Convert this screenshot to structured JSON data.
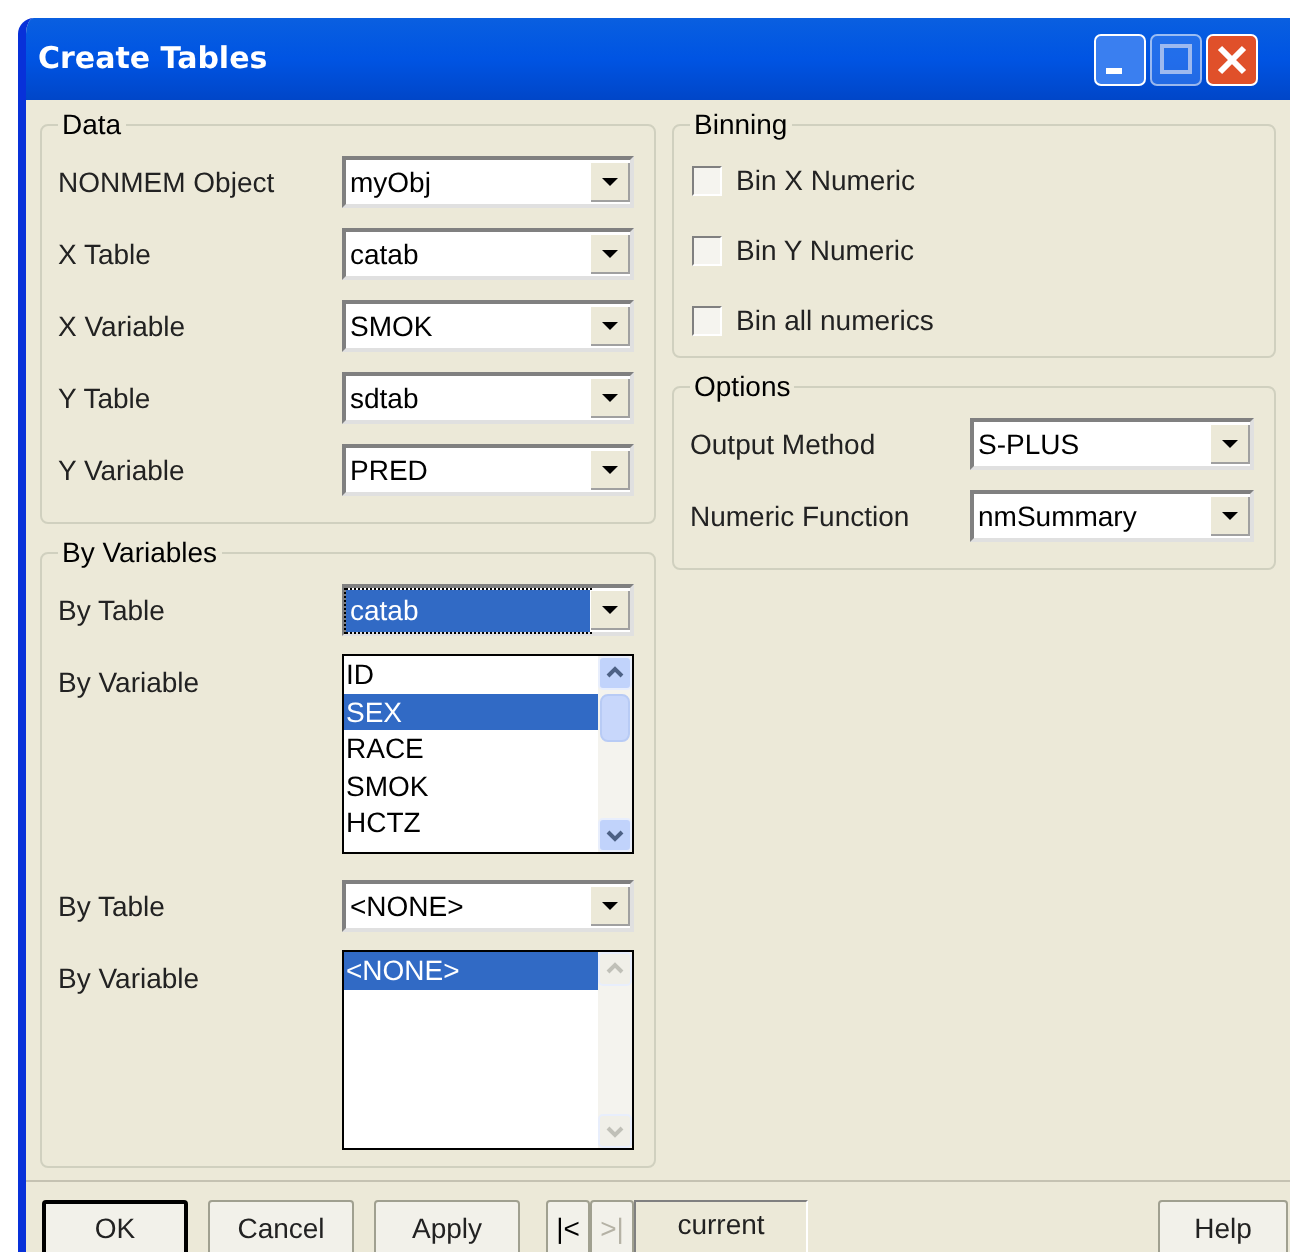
{
  "window": {
    "title": "Create Tables"
  },
  "data_group": {
    "title": "Data",
    "rows": [
      {
        "label": "NONMEM Object",
        "value": "myObj"
      },
      {
        "label": "X Table",
        "value": "catab"
      },
      {
        "label": "X Variable",
        "value": "SMOK"
      },
      {
        "label": "Y Table",
        "value": "sdtab"
      },
      {
        "label": "Y Variable",
        "value": "PRED"
      }
    ]
  },
  "by_variables": {
    "title": "By Variables",
    "sets": [
      {
        "table_label": "By Table",
        "table_value": "catab",
        "table_highlighted": true,
        "variable_label": "By Variable",
        "scroll_enabled": true,
        "items": [
          {
            "text": "ID",
            "selected": false
          },
          {
            "text": "SEX",
            "selected": true
          },
          {
            "text": "RACE",
            "selected": false
          },
          {
            "text": "SMOK",
            "selected": false
          },
          {
            "text": "HCTZ",
            "selected": false
          }
        ]
      },
      {
        "table_label": "By Table",
        "table_value": "<NONE>",
        "table_highlighted": false,
        "variable_label": "By Variable",
        "scroll_enabled": false,
        "items": [
          {
            "text": "<NONE>",
            "selected": true
          }
        ]
      }
    ]
  },
  "binning": {
    "title": "Binning",
    "checkboxes": [
      {
        "label": "Bin X Numeric",
        "checked": false
      },
      {
        "label": "Bin Y Numeric",
        "checked": false
      },
      {
        "label": "Bin all numerics",
        "checked": false
      }
    ]
  },
  "options": {
    "title": "Options",
    "rows": [
      {
        "label": "Output Method",
        "value": "S-PLUS"
      },
      {
        "label": "Numeric Function",
        "value": "nmSummary"
      }
    ]
  },
  "footer": {
    "buttons": [
      {
        "label": "OK",
        "default": true
      },
      {
        "label": "Cancel",
        "default": false
      },
      {
        "label": "Apply",
        "default": false
      }
    ],
    "nav": [
      {
        "label": "|<",
        "disabled": false
      },
      {
        "label": ">|",
        "disabled": true
      }
    ],
    "current": "current",
    "help": "Help"
  }
}
